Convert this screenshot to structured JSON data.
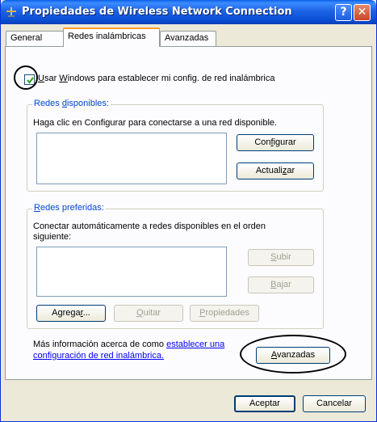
{
  "window": {
    "title": "Propiedades de Wireless Network Connection",
    "help_glyph": "?",
    "close_glyph": "✕"
  },
  "tabs": [
    {
      "label": "General",
      "active": false
    },
    {
      "label": "Redes inalámbricas",
      "active": true
    },
    {
      "label": "Avanzadas",
      "active": false
    }
  ],
  "use_windows": {
    "checked": true,
    "label_pre": "",
    "label_u": "U",
    "label_mid": "sar ",
    "label_u2": "W",
    "label_post": "indows para establecer mi config. de red inalámbrica"
  },
  "available": {
    "legend_pre": "Redes ",
    "legend_u": "d",
    "legend_post": "isponibles:",
    "description": "Haga clic en Configurar para conectarse a una red disponible.",
    "configure_pre": "Con",
    "configure_u": "f",
    "configure_post": "igurar",
    "refresh_pre": "Actuali",
    "refresh_u": "z",
    "refresh_post": "ar"
  },
  "preferred": {
    "legend_pre": "",
    "legend_u": "R",
    "legend_post": "edes preferidas:",
    "description_line1": "Conectar automáticamente a redes disponibles en el orden",
    "description_line2": "siguiente:",
    "up_u": "S",
    "up_post": "ubir",
    "down_u": "B",
    "down_post": "ajar",
    "add_pre": "Agrega",
    "add_u": "r",
    "add_post": "...",
    "remove_u": "Q",
    "remove_post": "uitar",
    "props_u": "P",
    "props_post": "ropiedades"
  },
  "info": {
    "text": "Más información acerca de como ",
    "link1": "establecer una",
    "link2": "configuración de red inalámbrica."
  },
  "advanced_button": {
    "pre": "",
    "u": "A",
    "post": "vanzadas"
  },
  "footer": {
    "ok": "Aceptar",
    "cancel": "Cancelar"
  },
  "colors": {
    "titlebar": "#0a5fe8",
    "dialog_bg": "#ece9d8",
    "group_legend": "#0046d5",
    "link": "#0000ff",
    "active_tab_accent": "#ff9d2a"
  }
}
